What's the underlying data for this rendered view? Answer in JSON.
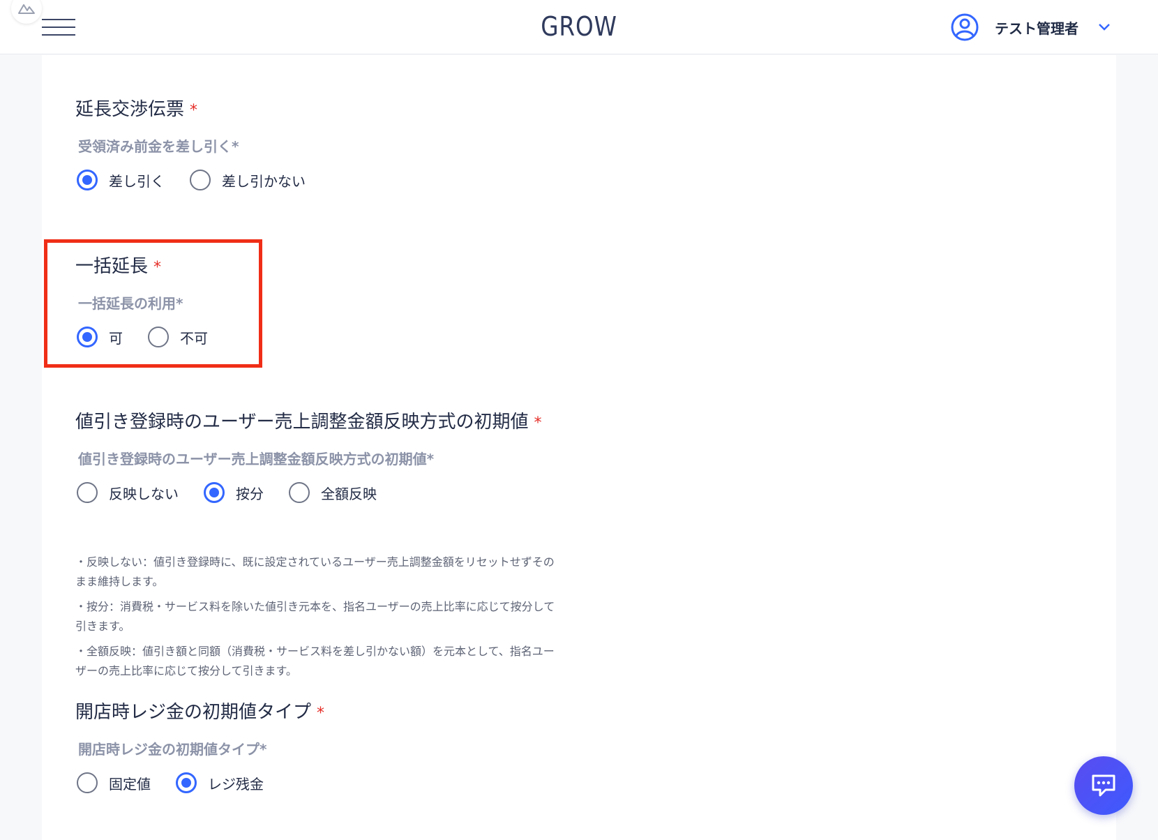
{
  "header": {
    "brand": "GROW",
    "user_name": "テスト管理者"
  },
  "sections": {
    "s1": {
      "title": "延長交渉伝票",
      "required_mark": "*",
      "sub_label": "受領済み前金を差し引く*",
      "options": [
        {
          "label": "差し引く",
          "checked": true
        },
        {
          "label": "差し引かない",
          "checked": false
        }
      ]
    },
    "s2": {
      "title": "一括延長",
      "required_mark": "*",
      "sub_label": "一括延長の利用*",
      "options": [
        {
          "label": "可",
          "checked": true
        },
        {
          "label": "不可",
          "checked": false
        }
      ]
    },
    "s3": {
      "title": "値引き登録時のユーザー売上調整金額反映方式の初期値",
      "required_mark": "*",
      "sub_label": "値引き登録時のユーザー売上調整金額反映方式の初期値*",
      "options": [
        {
          "label": "反映しない",
          "checked": false
        },
        {
          "label": "按分",
          "checked": true
        },
        {
          "label": "全額反映",
          "checked": false
        }
      ],
      "notes": [
        "・反映しない：値引き登録時に、既に設定されているユーザー売上調整金額をリセットせずそのまま維持します。",
        "・按分：消費税・サービス料を除いた値引き元本を、指名ユーザーの売上比率に応じて按分して引きます。",
        "・全額反映：値引き額と同額（消費税・サービス料を差し引かない額）を元本として、指名ユーザーの売上比率に応じて按分して引きます。"
      ]
    },
    "s4": {
      "title": "開店時レジ金の初期値タイプ",
      "required_mark": "*",
      "sub_label": "開店時レジ金の初期値タイプ*",
      "options": [
        {
          "label": "固定値",
          "checked": false
        },
        {
          "label": "レジ残金",
          "checked": true
        }
      ]
    }
  },
  "colors": {
    "accent": "#3366ff",
    "required": "#e52d27",
    "highlight": "#f02e17"
  },
  "icons": {
    "menu": "hamburger-icon",
    "user": "user-circle-icon",
    "dropdown": "chevron-down-icon",
    "chat": "chat-bubble-icon"
  }
}
